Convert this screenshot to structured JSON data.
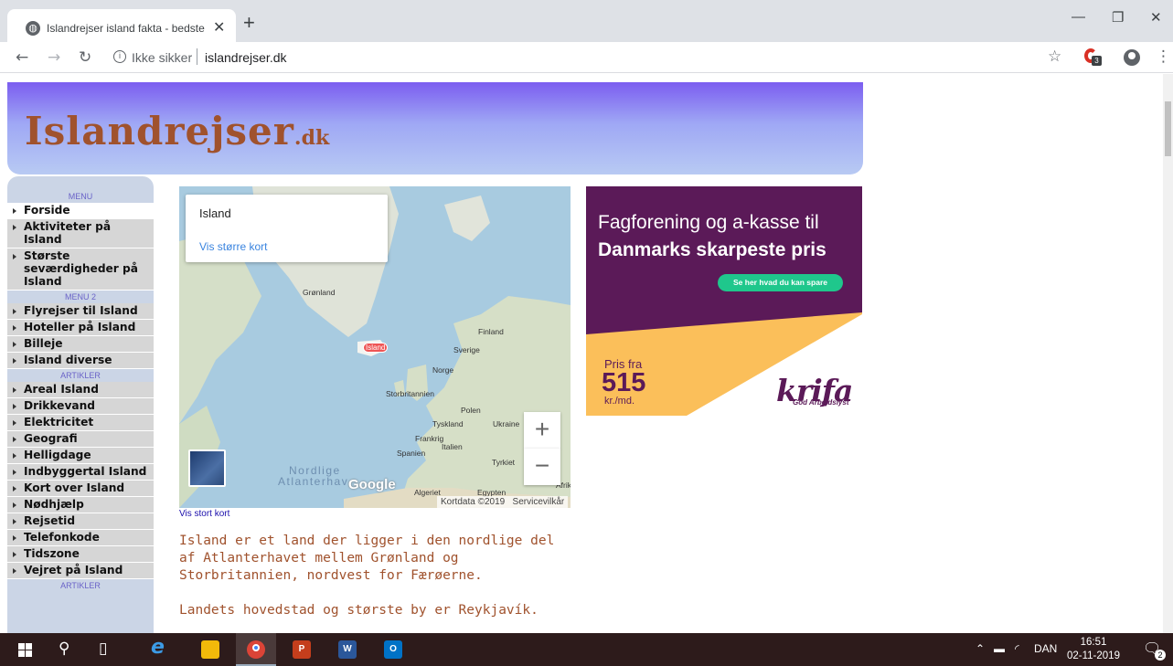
{
  "browser": {
    "tab_title": "Islandrejser island fakta - bedste",
    "tab_close": "✕",
    "new_tab": "+",
    "security_label": "Ikke sikker",
    "url": "islandrejser.dk",
    "extension_badge": "3"
  },
  "site": {
    "logo_main": "Islandrejser",
    "logo_suffix": ".dk"
  },
  "menu": {
    "heading_1": "MENU",
    "items_1": [
      {
        "label": "Forside",
        "active": true
      },
      {
        "label": "Aktiviteter på Island"
      },
      {
        "label": "Største seværdigheder på Island"
      }
    ],
    "heading_2": "MENU 2",
    "items_2": [
      {
        "label": "Flyrejser til Island"
      },
      {
        "label": "Hoteller på Island"
      },
      {
        "label": "Billeje"
      },
      {
        "label": "Island diverse"
      }
    ],
    "heading_3": "ARTIKLER",
    "items_3": [
      {
        "label": "Areal Island"
      },
      {
        "label": "Drikkevand"
      },
      {
        "label": "Elektricitet"
      },
      {
        "label": "Geografi"
      },
      {
        "label": "Helligdage"
      },
      {
        "label": "Indbyggertal Island"
      },
      {
        "label": "Kort over Island"
      },
      {
        "label": "Nødhjælp"
      },
      {
        "label": "Rejsetid"
      },
      {
        "label": "Telefonkode"
      },
      {
        "label": "Tidszone"
      },
      {
        "label": "Vejret på Island"
      }
    ],
    "heading_4": "ARTIKLER"
  },
  "map": {
    "card_title": "Island",
    "card_link": "Vis større kort",
    "labels": {
      "greenland": "Grønland",
      "island": "Island",
      "finland": "Finland",
      "sweden": "Sverige",
      "norway": "Norge",
      "uk": "Storbritannien",
      "poland": "Polen",
      "germany": "Tyskland",
      "ukraine": "Ukraine",
      "france": "Frankrig",
      "italy": "Italien",
      "spain": "Spanien",
      "turkey": "Tyrkiet",
      "algeria": "Algeriet",
      "egypt": "Egypten",
      "africa_label": "Afrika",
      "ocean_line1": "Nordlige",
      "ocean_line2": "Atlanterhav"
    },
    "google": "Google",
    "attribution": "Kortdata ©2019",
    "terms": "Servicevilkår",
    "zoom_in": "+",
    "zoom_out": "−",
    "below_link": "Vis stort kort"
  },
  "ad": {
    "line1": "Fagforening og a-kasse til",
    "line2": "Danmarks skarpeste pris",
    "button": "Se her hvad du kan spare",
    "price_prefix": "Pris fra",
    "price": "515",
    "price_unit": "kr./md.",
    "brand": "krifa",
    "tagline": "God Arbejdslyst",
    "colors": {
      "purple": "#5b1a58",
      "yellow": "#fbbf5a",
      "green": "#1fc78c"
    }
  },
  "content": {
    "paragraph_1": "Island er et land der ligger i den nordlige del af Atlanterhavet mellem Grønland og Storbritannien, nordvest for Færøerne.",
    "paragraph_2": "Landets hovedstad og største by er Reykjavík."
  },
  "taskbar": {
    "language": "DAN",
    "time": "16:51",
    "date": "02-11-2019",
    "notification_count": "2"
  }
}
